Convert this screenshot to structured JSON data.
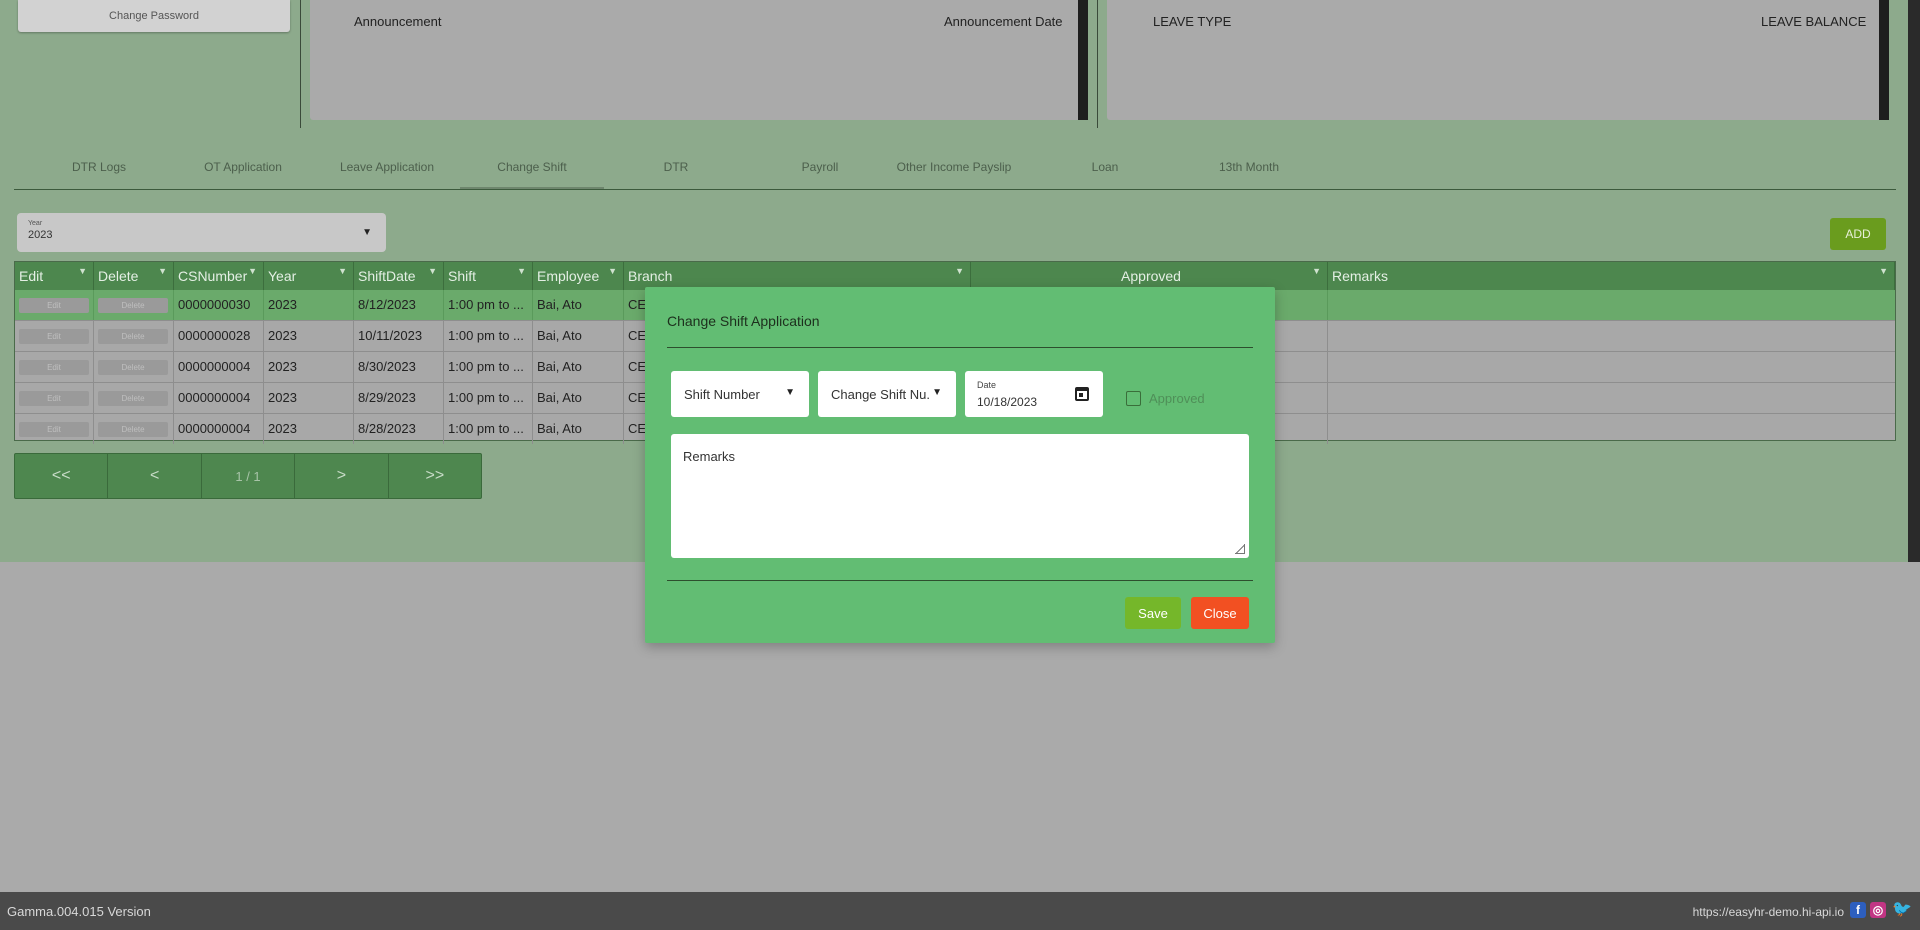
{
  "top": {
    "change_password": "Change Password",
    "announcement_col": "Announcement",
    "announcement_date_col": "Announcement Date",
    "leave_type_col": "LEAVE TYPE",
    "leave_balance_col": "LEAVE BALANCE"
  },
  "tabs": [
    "DTR Logs",
    "OT Application",
    "Leave Application",
    "Change Shift",
    "DTR",
    "Payroll",
    "Other Income Payslip",
    "Loan",
    "13th Month"
  ],
  "active_tab": "Change Shift",
  "filter": {
    "year_label": "Year",
    "year_value": "2023",
    "add_button": "ADD"
  },
  "grid": {
    "columns": [
      "Edit",
      "Delete",
      "CSNumber",
      "Year",
      "ShiftDate",
      "Shift",
      "Employee",
      "Branch",
      "Approved",
      "Remarks"
    ],
    "edit_label": "Edit",
    "delete_label": "Delete",
    "rows": [
      {
        "csnumber": "0000000030",
        "year": "2023",
        "shiftdate": "8/12/2023",
        "shift": "1:00 pm to ...",
        "employee": "Bai, Ato",
        "branch": "CE"
      },
      {
        "csnumber": "0000000028",
        "year": "2023",
        "shiftdate": "10/11/2023",
        "shift": "1:00 pm to ...",
        "employee": "Bai, Ato",
        "branch": "CE"
      },
      {
        "csnumber": "0000000004",
        "year": "2023",
        "shiftdate": "8/30/2023",
        "shift": "1:00 pm to ...",
        "employee": "Bai, Ato",
        "branch": "CE"
      },
      {
        "csnumber": "0000000004",
        "year": "2023",
        "shiftdate": "8/29/2023",
        "shift": "1:00 pm to ...",
        "employee": "Bai, Ato",
        "branch": "CE"
      },
      {
        "csnumber": "0000000004",
        "year": "2023",
        "shiftdate": "8/28/2023",
        "shift": "1:00 pm to ...",
        "employee": "Bai, Ato",
        "branch": "CE"
      }
    ]
  },
  "pager": {
    "first": "<<",
    "prev": "<",
    "info": "1 / 1",
    "next": ">",
    "last": ">>"
  },
  "modal": {
    "title": "Change Shift Application",
    "shift_number": "Shift Number",
    "change_shift_number": "Change Shift Nu...",
    "date_label": "Date",
    "date_value": "10/18/2023",
    "approved_label": "Approved",
    "remarks_label": "Remarks",
    "save": "Save",
    "close": "Close"
  },
  "footer": {
    "version": "Gamma.004.015 Version",
    "site": "https://easyhr-demo.hi-api.io"
  },
  "colors": {
    "modal_bg": "#62bd73",
    "save": "#75b72a",
    "close": "#f25022",
    "grid_header": "#4d874e"
  }
}
